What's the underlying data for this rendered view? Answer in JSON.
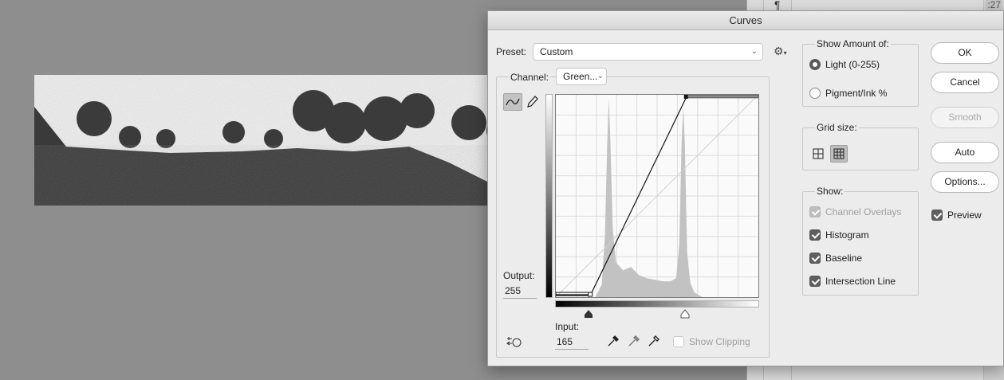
{
  "dialog": {
    "title": "Curves"
  },
  "preset": {
    "label": "Preset:",
    "value": "Custom"
  },
  "channel": {
    "label": "Channel:",
    "value": "Green..."
  },
  "output": {
    "label": "Output:",
    "value": "255"
  },
  "input": {
    "label": "Input:",
    "value": "165"
  },
  "show_clipping": "Show Clipping",
  "show_amount": {
    "title": "Show Amount of:",
    "light": "Light  (0-255)",
    "pigment": "Pigment/Ink %"
  },
  "grid_size": {
    "title": "Grid size:"
  },
  "show": {
    "title": "Show:",
    "channel_overlays": "Channel Overlays",
    "histogram": "Histogram",
    "baseline": "Baseline",
    "intersection_line": "Intersection Line"
  },
  "buttons": {
    "ok": "OK",
    "cancel": "Cancel",
    "smooth": "Smooth",
    "auto": "Auto",
    "options": "Options..."
  },
  "preview": "Preview",
  "panel": {
    "pilcrow": "¶",
    "number": ":27"
  },
  "icons": [
    "curve-tool-icon",
    "pencil-icon",
    "gear-icon",
    "black-eyedropper-icon",
    "gray-eyedropper-icon",
    "white-eyedropper-icon",
    "targeted-adjustment-icon",
    "grid-4-icon",
    "grid-10-icon"
  ]
}
